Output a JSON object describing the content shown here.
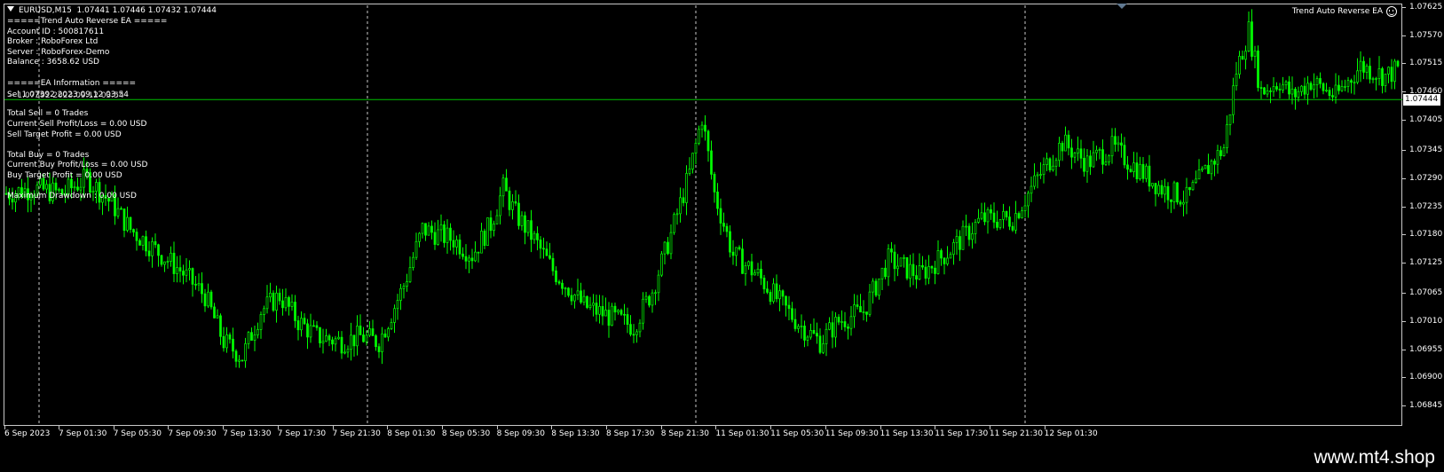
{
  "header": {
    "symbol_line": "EURUSD,M15  1.07441 1.07446 1.07432 1.07444",
    "ea_name": "Trend Auto Reverse EA"
  },
  "overlay": {
    "lines": [
      "=====Trend Auto Reverse EA =====",
      "Account ID : 500817611",
      "Broker : RoboForex Ltd",
      "Server : RoboForex-Demo",
      "Balance : 3658.62 USD",
      "",
      "=====EA Information =====",
      "",
      "",
      "Total Sell = 0 Trades",
      "Current Sell Profit/Loss = 0.00 USD",
      "Sell Target Profit = 0.00 USD",
      "",
      "Total Buy = 0 Trades",
      "Current Buy Profit/Loss = 0.00 USD",
      "Buy Target Profit = 0.00 USD",
      "",
      "Maximum Drawdown : 0.00 USD"
    ],
    "overlap_a": "Sel 1.07392 2023.09.12 03:54",
    "overlap_b": "-- 1.07392 2023.09.12 03:54"
  },
  "current_price": "1.07444",
  "watermark": "www.mt4.shop",
  "colors": {
    "background": "#000000",
    "candle": "#00ff00",
    "bid_line": "#00c000",
    "grid": "#c8c8c8",
    "frame": "#c8c8c8"
  },
  "chart_data": {
    "type": "candlestick",
    "symbol": "EURUSD",
    "timeframe": "M15",
    "ylim": [
      1.06845,
      1.07625
    ],
    "price_ticks": [
      "1.07625",
      "1.07570",
      "1.07515",
      "1.07460",
      "1.07405",
      "1.07345",
      "1.07290",
      "1.07235",
      "1.07180",
      "1.07125",
      "1.07065",
      "1.07010",
      "1.06955",
      "1.06900",
      "1.06845"
    ],
    "time_ticks": [
      "6 Sep 2023",
      "7 Sep 01:30",
      "7 Sep 05:30",
      "7 Sep 09:30",
      "7 Sep 13:30",
      "7 Sep 17:30",
      "7 Sep 21:30",
      "8 Sep 01:30",
      "8 Sep 05:30",
      "8 Sep 09:30",
      "8 Sep 13:30",
      "8 Sep 17:30",
      "8 Sep 21:30",
      "11 Sep 01:30",
      "11 Sep 05:30",
      "11 Sep 09:30",
      "11 Sep 13:30",
      "11 Sep 17:30",
      "11 Sep 21:30",
      "12 Sep 01:30"
    ],
    "period_separators": [
      "7 Sep 00:00",
      "8 Sep 00:00",
      "11 Sep 00:00",
      "12 Sep 00:00"
    ],
    "bid": 1.07444,
    "price_path": [
      [
        0,
        1.0726
      ],
      [
        9,
        1.0727
      ],
      [
        18,
        1.0726
      ],
      [
        26,
        1.0729
      ],
      [
        34,
        1.0724
      ],
      [
        40,
        1.0719
      ],
      [
        46,
        1.0716
      ],
      [
        56,
        1.0711
      ],
      [
        64,
        1.0706
      ],
      [
        70,
        1.0697
      ],
      [
        76,
        1.0694
      ],
      [
        82,
        1.0703
      ],
      [
        88,
        1.0706
      ],
      [
        94,
        1.0701
      ],
      [
        100,
        1.0698
      ],
      [
        108,
        1.0697
      ],
      [
        114,
        1.0698
      ],
      [
        120,
        1.0697
      ],
      [
        128,
        1.0708
      ],
      [
        134,
        1.0719
      ],
      [
        144,
        1.0717
      ],
      [
        150,
        1.0714
      ],
      [
        156,
        1.072
      ],
      [
        160,
        1.0727
      ],
      [
        164,
        1.0722
      ],
      [
        170,
        1.0717
      ],
      [
        176,
        1.0711
      ],
      [
        186,
        1.0704
      ],
      [
        194,
        1.0702
      ],
      [
        202,
        1.07
      ],
      [
        208,
        1.0707
      ],
      [
        214,
        1.0718
      ],
      [
        220,
        1.073
      ],
      [
        224,
        1.0741
      ],
      [
        228,
        1.0726
      ],
      [
        234,
        1.0714
      ],
      [
        242,
        1.071
      ],
      [
        250,
        1.0704
      ],
      [
        256,
        1.07
      ],
      [
        262,
        1.0697
      ],
      [
        268,
        1.0701
      ],
      [
        276,
        1.0703
      ],
      [
        284,
        1.0713
      ],
      [
        294,
        1.071
      ],
      [
        304,
        1.0715
      ],
      [
        314,
        1.0721
      ],
      [
        324,
        1.0721
      ],
      [
        332,
        1.0729
      ],
      [
        340,
        1.0736
      ],
      [
        348,
        1.0732
      ],
      [
        356,
        1.0735
      ],
      [
        364,
        1.0731
      ],
      [
        372,
        1.0727
      ],
      [
        380,
        1.0725
      ],
      [
        388,
        1.0732
      ],
      [
        392,
        1.0735
      ],
      [
        396,
        1.075
      ],
      [
        400,
        1.0758
      ],
      [
        404,
        1.0746
      ],
      [
        410,
        1.0748
      ],
      [
        414,
        1.0745
      ],
      [
        420,
        1.0748
      ],
      [
        428,
        1.0745
      ],
      [
        436,
        1.0751
      ],
      [
        444,
        1.0749
      ],
      [
        450,
        1.0751
      ],
      [
        456,
        1.0747
      ],
      [
        460,
        1.0743
      ]
    ]
  }
}
